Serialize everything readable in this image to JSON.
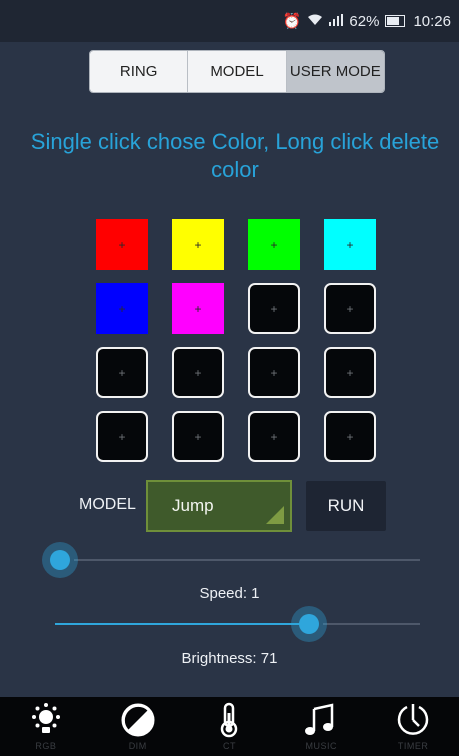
{
  "status_bar": {
    "battery": "62%",
    "time": "10:26",
    "icons": [
      "alarm-icon",
      "wifi-icon",
      "signal-icon",
      "battery-icon"
    ]
  },
  "tabs": [
    {
      "label": "RING",
      "active": false
    },
    {
      "label": "MODEL",
      "active": false
    },
    {
      "label": "USER MODE",
      "active": true
    }
  ],
  "instruction": "Single click chose Color, Long click delete color",
  "swatches": [
    {
      "color": "#ff0000",
      "glyph": "+"
    },
    {
      "color": "#ffff00",
      "glyph": "+"
    },
    {
      "color": "#00ff00",
      "glyph": "+"
    },
    {
      "color": "#00ffff",
      "glyph": "+"
    },
    {
      "color": "#0000ff",
      "glyph": "+"
    },
    {
      "color": "#ff00ff",
      "glyph": "+"
    },
    {
      "color": "",
      "glyph": "+"
    },
    {
      "color": "",
      "glyph": "+"
    },
    {
      "color": "",
      "glyph": "+"
    },
    {
      "color": "",
      "glyph": "+"
    },
    {
      "color": "",
      "glyph": "+"
    },
    {
      "color": "",
      "glyph": "+"
    },
    {
      "color": "",
      "glyph": "+"
    },
    {
      "color": "",
      "glyph": "+"
    },
    {
      "color": "",
      "glyph": "+"
    },
    {
      "color": "",
      "glyph": "+"
    }
  ],
  "model": {
    "label": "MODEL",
    "selected": "Jump",
    "run_label": "RUN"
  },
  "speed": {
    "label": "Speed: 1",
    "value": 1,
    "fraction": 0.0
  },
  "brightness": {
    "label": "Brightness: 71",
    "value": 71,
    "fraction": 0.71
  },
  "colors": {
    "accent": "#2fa6dc",
    "background": "#2a3446",
    "dropdown": "#3f5a2b"
  },
  "nav": [
    {
      "label": "RGB",
      "icon": "bulb-icon"
    },
    {
      "label": "DIM",
      "icon": "dim-icon"
    },
    {
      "label": "CT",
      "icon": "thermometer-icon"
    },
    {
      "label": "MUSIC",
      "icon": "music-icon"
    },
    {
      "label": "TIMER",
      "icon": "timer-icon"
    }
  ]
}
